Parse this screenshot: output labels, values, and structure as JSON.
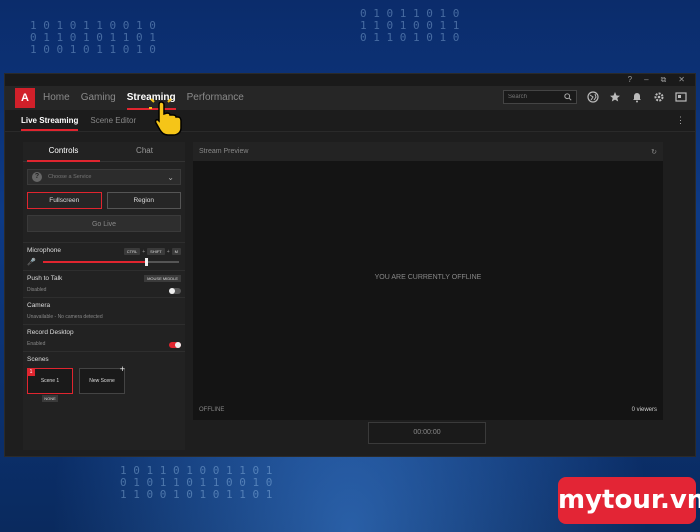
{
  "titlebar": {
    "help": "?",
    "minimize": "–",
    "restore": "⧉",
    "close": "✕"
  },
  "nav": {
    "logo": "A",
    "items": [
      "Home",
      "Gaming",
      "Streaming",
      "Performance"
    ],
    "active": "Streaming",
    "search_placeholder": "Search"
  },
  "subnav": {
    "items": [
      "Live Streaming",
      "Scene Editor"
    ],
    "active": "Live Streaming",
    "more": "⋮"
  },
  "left_panel": {
    "tabs": [
      "Controls",
      "Chat"
    ],
    "service_placeholder": "Choose a Service",
    "capture_buttons": [
      "Fullscreen",
      "Region"
    ],
    "go_live": "Go Live",
    "microphone": {
      "label": "Microphone",
      "keys": [
        "CTRL",
        "SHIFT",
        "M"
      ],
      "volume_percent": 76
    },
    "push_to_talk": {
      "label": "Push to Talk",
      "status": "Disabled",
      "badge": "MOUSE MIDDLE"
    },
    "camera": {
      "label": "Camera",
      "status": "Unavailable - No camera detected"
    },
    "record_desktop": {
      "label": "Record Desktop",
      "status": "Enabled"
    },
    "scenes": {
      "label": "Scenes",
      "items": [
        "Scene 1",
        "New Scene"
      ],
      "selected_number": "1",
      "hotkey": "NONE"
    }
  },
  "preview": {
    "title": "Stream Preview",
    "message": "YOU ARE CURRENTLY OFFLINE",
    "status": "OFFLINE",
    "viewers": "0 viewers",
    "timer": "00:00:00"
  },
  "watermark": "mytour.vn",
  "colors": {
    "accent": "#e0252f",
    "panel": "#222222",
    "background": "#0b2c6b"
  }
}
